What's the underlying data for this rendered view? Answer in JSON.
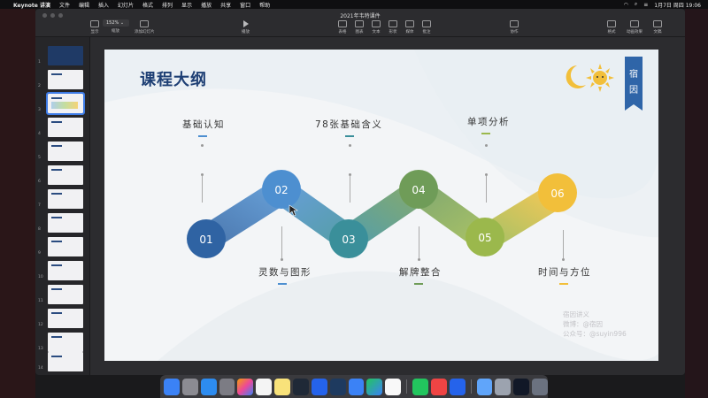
{
  "menubar": {
    "app": "Keynote 讲演",
    "menus": [
      "文件",
      "编辑",
      "插入",
      "幻灯片",
      "格式",
      "排列",
      "显示",
      "播放",
      "共享",
      "窗口",
      "帮助"
    ],
    "date_time": "1月7日 周四 19:06"
  },
  "toolbar": {
    "document_title": "2021年韦特课件",
    "zoom": "152%",
    "buttons": {
      "view": "显示",
      "zoom": "缩放",
      "add_slide": "添加幻灯片",
      "play": "播放",
      "table": "表格",
      "chart": "图表",
      "text": "文本",
      "shape": "形状",
      "media": "媒体",
      "comment": "批注",
      "share": "协作",
      "format": "格式",
      "animate": "动画效果",
      "document": "文稿"
    }
  },
  "sidebar": {
    "slide_numbers": [
      "1",
      "2",
      "3",
      "4",
      "5",
      "6",
      "7",
      "8",
      "9",
      "10",
      "11",
      "12",
      "13",
      "14"
    ],
    "selected": 3
  },
  "slide": {
    "title": "课程大纲",
    "logo_chars": [
      "宿",
      "因"
    ],
    "nodes": [
      {
        "num": "01",
        "label": "灵数与图形",
        "color": "#2f63a3"
      },
      {
        "num": "02",
        "label": "基础认知",
        "color": "#4d8fd0"
      },
      {
        "num": "03",
        "label": "78张基础含义",
        "color": "#3a8f9a"
      },
      {
        "num": "04",
        "label": "解牌整合",
        "color": "#6f9c58"
      },
      {
        "num": "05",
        "label": "单项分析",
        "color": "#9bb84c"
      },
      {
        "num": "06",
        "label": "时间与方位",
        "color": "#f2bf3a"
      }
    ],
    "top_labels": {
      "l1": "基础认知",
      "l2": "78张基础含义",
      "l3": "单项分析"
    },
    "bottom_labels": {
      "l1": "灵数与图形",
      "l2": "解牌整合",
      "l3": "时间与方位"
    },
    "watermark": [
      "宿因讲义",
      "微博：@宿因",
      "公众号：@suyin996"
    ]
  },
  "colors": {
    "title": "#1e3f74",
    "accent_blue": "#4d8fd0",
    "accent_teal": "#3a8f9a",
    "accent_green": "#6f9c58",
    "accent_yellow": "#f2bf3a"
  }
}
